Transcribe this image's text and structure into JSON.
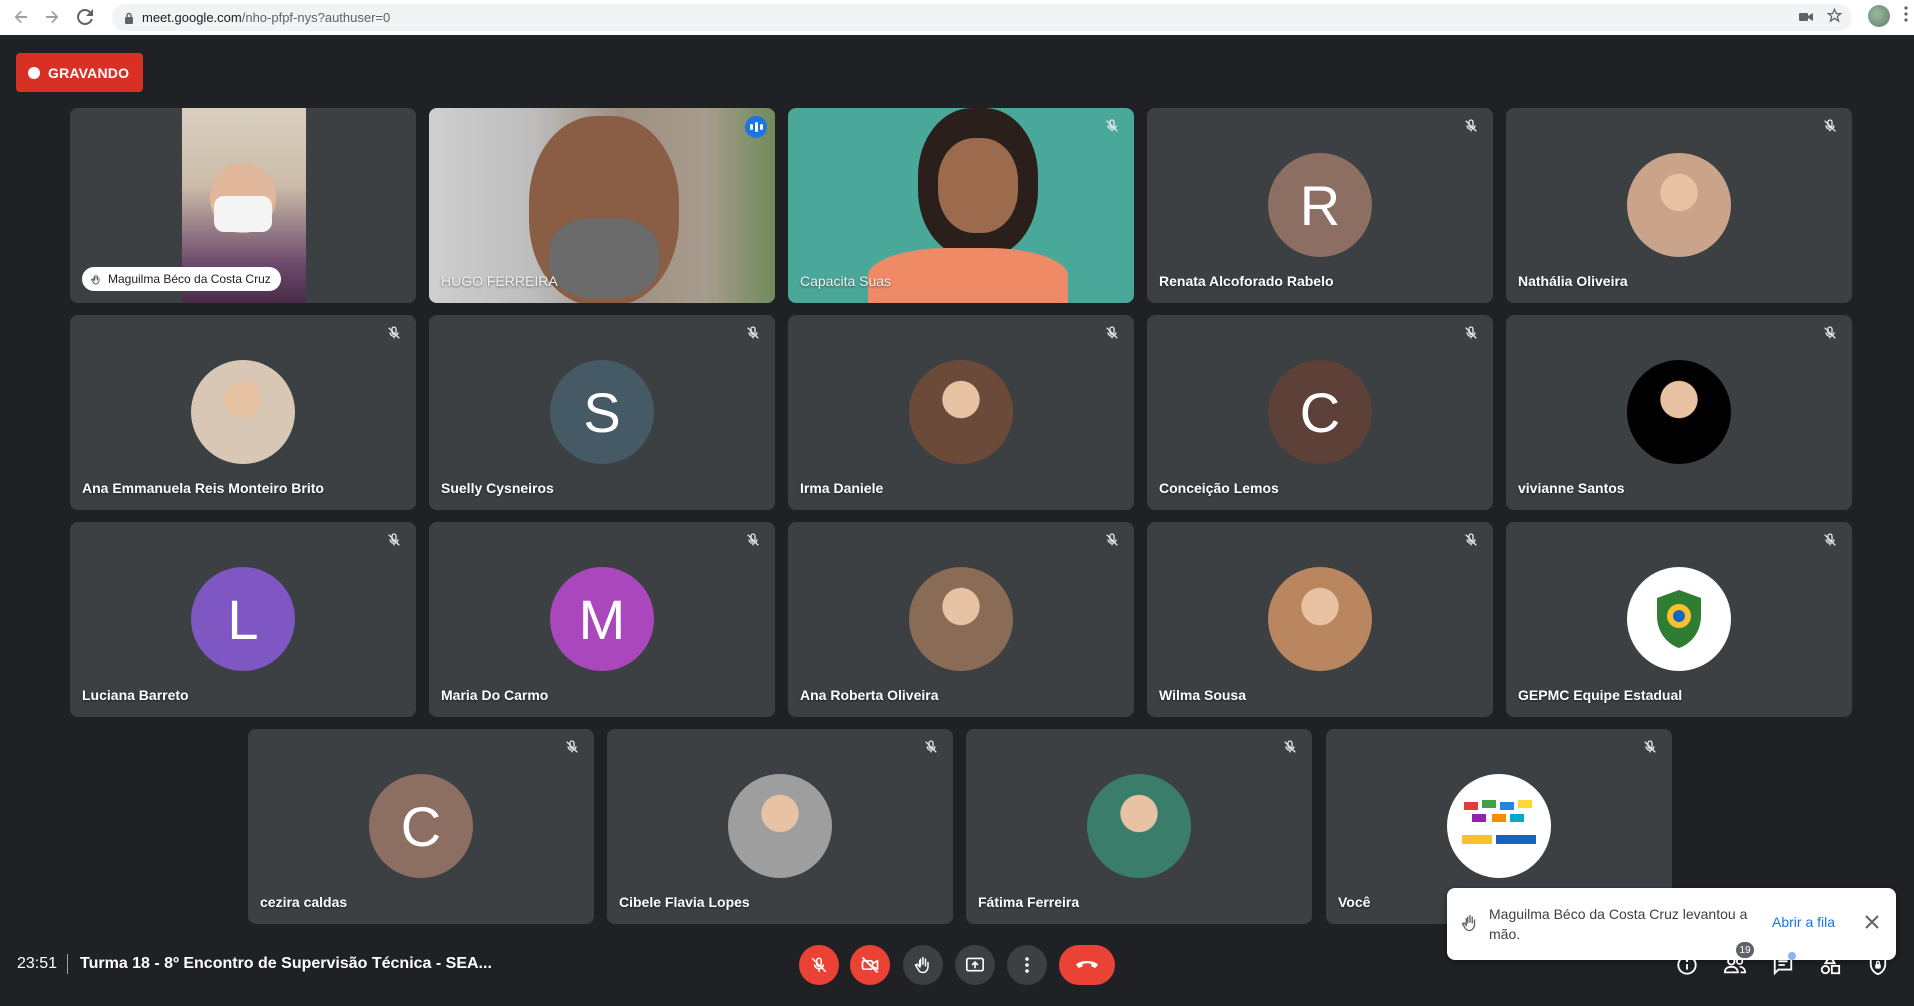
{
  "browser": {
    "url_host": "meet.google.com",
    "url_path": "/nho-pfpf-nys?authuser=0"
  },
  "recording": {
    "label": "GRAVANDO"
  },
  "tiles": [
    {
      "name": "Maguilma Béco da Costa Cruz",
      "kind": "video-hand",
      "avatar_color": ""
    },
    {
      "name": "HUGO FERREIRA",
      "kind": "video-active",
      "avatar_color": ""
    },
    {
      "name": "Capacita Suas",
      "kind": "video",
      "avatar_color": ""
    },
    {
      "name": "Renata Alcoforado Rabelo",
      "kind": "letter",
      "letter": "R",
      "avatar_color": "#8d6e63"
    },
    {
      "name": "Nathália Oliveira",
      "kind": "photo",
      "avatar_color": "#c9a48b"
    },
    {
      "name": "Ana Emmanuela Reis Monteiro Brito",
      "kind": "photo",
      "avatar_color": "#d9c7b6"
    },
    {
      "name": "Suelly Cysneiros",
      "kind": "letter",
      "letter": "S",
      "avatar_color": "#455a64"
    },
    {
      "name": "Irma Daniele",
      "kind": "photo",
      "avatar_color": "#6b4a3a"
    },
    {
      "name": "Conceição Lemos",
      "kind": "letter",
      "letter": "C",
      "avatar_color": "#5d4037"
    },
    {
      "name": "vivianne Santos",
      "kind": "photo",
      "avatar_color": "#000000"
    },
    {
      "name": "Luciana Barreto",
      "kind": "letter",
      "letter": "L",
      "avatar_color": "#7e57c2"
    },
    {
      "name": "Maria Do Carmo",
      "kind": "letter",
      "letter": "M",
      "avatar_color": "#ab47bc"
    },
    {
      "name": "Ana Roberta Oliveira",
      "kind": "photo",
      "avatar_color": "#8a6b55"
    },
    {
      "name": "Wilma Sousa",
      "kind": "photo",
      "avatar_color": "#b9865f"
    },
    {
      "name": "GEPMC Equipe Estadual",
      "kind": "logo",
      "avatar_color": "#ffffff"
    },
    {
      "name": "cezira caldas",
      "kind": "letter",
      "letter": "C",
      "avatar_color": "#8d6e63"
    },
    {
      "name": "Cibele Flavia Lopes",
      "kind": "photo",
      "avatar_color": "#9e9e9e"
    },
    {
      "name": "Fátima Ferreira",
      "kind": "photo",
      "avatar_color": "#3a7d6a"
    },
    {
      "name": "Você",
      "kind": "logo2",
      "avatar_color": "#ffffff"
    }
  ],
  "toast": {
    "message": "Maguilma Béco da Costa Cruz levantou a mão.",
    "action": "Abrir a fila"
  },
  "bottom": {
    "time": "23:51",
    "meeting_title": "Turma 18 - 8º Encontro de Supervisão Técnica - SEA...",
    "participants_count": "19"
  },
  "icons": {
    "back": "arrow-left-icon",
    "forward": "arrow-right-icon",
    "reload": "reload-icon",
    "lock": "lock-icon",
    "camera": "camera-icon",
    "star": "star-icon",
    "mic_off": "mic-off-icon",
    "hand": "hand-icon",
    "close": "close-icon"
  },
  "colors": {
    "background": "#202124",
    "tile": "#3c4043",
    "recording": "#d93025",
    "end_call": "#ea4335",
    "accent": "#1a73e8"
  }
}
